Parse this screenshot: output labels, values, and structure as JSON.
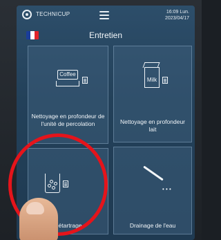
{
  "topbar": {
    "brand": "TECHNICUP",
    "time": "16:09 Lun.",
    "date": "2023/04/17",
    "logo_icon": "technicup-logo-icon",
    "menu_icon": "hamburger-menu-icon"
  },
  "page_title": "Entretien",
  "language_flag": {
    "icon": "french-flag-icon",
    "colors": [
      "#1a3d9a",
      "#ffffff",
      "#e0242a"
    ]
  },
  "tiles": [
    {
      "id": "brew-unit",
      "label": "Nettoyage en profondeur de l'unité de percolation",
      "icon": "coffee-machine-icon",
      "icon_text": "Coffee"
    },
    {
      "id": "milk",
      "label": "Nettoyage en profondeur lait",
      "icon": "milk-carton-icon",
      "icon_text": "Milk"
    },
    {
      "id": "descaling",
      "label": "Détartrage",
      "icon": "descaling-glass-icon"
    },
    {
      "id": "drain",
      "label": "Drainage de l'eau",
      "icon": "drain-wand-icon"
    }
  ],
  "colors": {
    "screen": "#23415a",
    "tile_border": "#8caac3",
    "annotation_circle": "#e5141b"
  }
}
